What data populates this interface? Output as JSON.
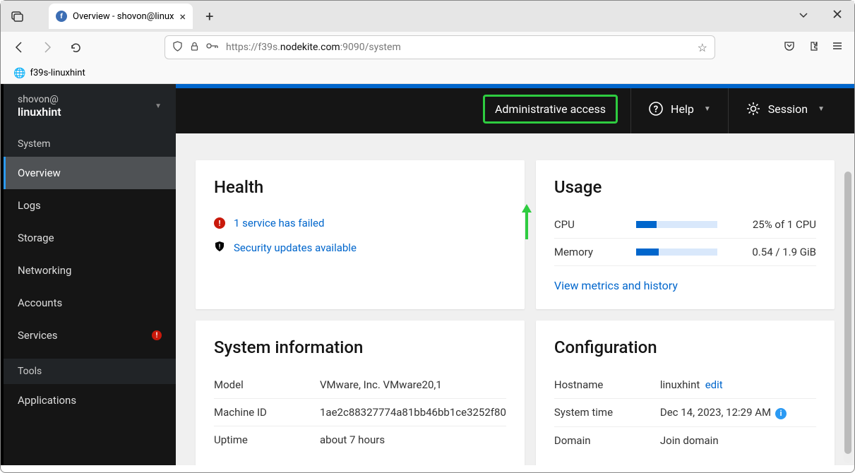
{
  "browser": {
    "tab_title": "Overview - shovon@linux",
    "url_prefix": "https://f39s.",
    "url_domain": "nodekite.com",
    "url_suffix": ":9090/system",
    "bookmark": "f39s-linuxhint"
  },
  "sidebar": {
    "user": "shovon@",
    "host": "linuxhint",
    "section1": "System",
    "items": [
      {
        "label": "Overview",
        "active": true,
        "badge": false
      },
      {
        "label": "Logs",
        "active": false,
        "badge": false
      },
      {
        "label": "Storage",
        "active": false,
        "badge": false
      },
      {
        "label": "Networking",
        "active": false,
        "badge": false
      },
      {
        "label": "Accounts",
        "active": false,
        "badge": false
      },
      {
        "label": "Services",
        "active": false,
        "badge": true
      }
    ],
    "section2": "Tools",
    "items2": [
      {
        "label": "Applications"
      }
    ]
  },
  "topbar": {
    "admin": "Administrative access",
    "help": "Help",
    "session": "Session"
  },
  "health": {
    "title": "Health",
    "failed": "1 service has failed",
    "security": "Security updates available"
  },
  "usage": {
    "title": "Usage",
    "cpu_label": "CPU",
    "cpu_percent": 25,
    "cpu_text": "25% of 1 CPU",
    "mem_label": "Memory",
    "mem_percent": 28,
    "mem_text": "0.54 / 1.9 GiB",
    "metrics_link": "View metrics and history"
  },
  "sysinfo": {
    "title": "System information",
    "rows": [
      {
        "label": "Model",
        "value": "VMware, Inc. VMware20,1"
      },
      {
        "label": "Machine ID",
        "value": "1ae2c88327774a81bb46bb1ce3252f80"
      },
      {
        "label": "Uptime",
        "value": "about 7 hours"
      }
    ]
  },
  "config": {
    "title": "Configuration",
    "hostname_label": "Hostname",
    "hostname_value": "linuxhint",
    "edit": "edit",
    "systime_label": "System time",
    "systime_value": "Dec 14, 2023, 12:29 AM",
    "domain_label": "Domain",
    "domain_value": "Join domain"
  }
}
